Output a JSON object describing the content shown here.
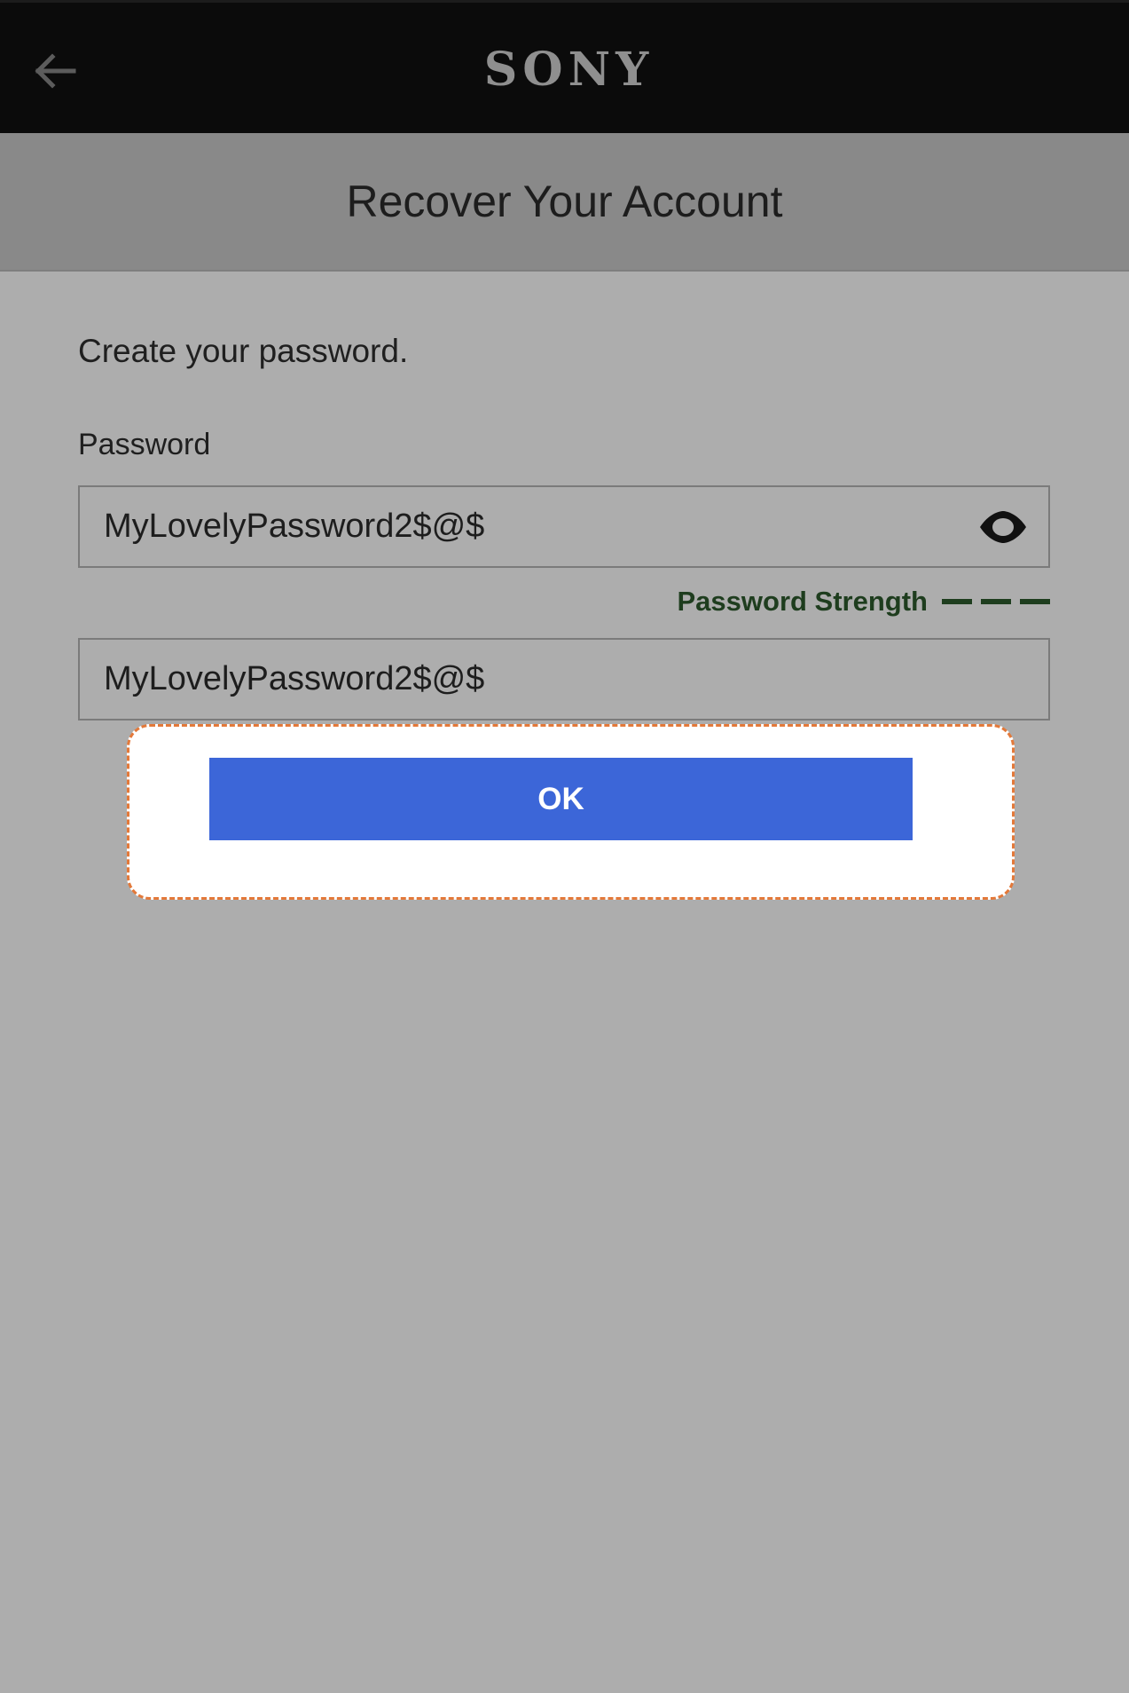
{
  "header": {
    "back_icon": "arrow-left-icon",
    "logo_text": "SONY"
  },
  "page": {
    "title": "Recover Your Account",
    "instruction": "Create your password."
  },
  "form": {
    "password_label": "Password",
    "password_value": "MyLovelyPassword2$@$",
    "toggle_icon": "eye-icon",
    "strength_label": "Password Strength",
    "strength_bars": 3,
    "confirm_value": "MyLovelyPassword2$@$",
    "ok_label": "OK"
  },
  "colors": {
    "topbar": "#0b0b0b",
    "subheader": "#898989",
    "background": "#adadad",
    "ok_button": "#3c66d8",
    "strength": "#1e3d1e",
    "highlight_border": "#e3793a"
  }
}
